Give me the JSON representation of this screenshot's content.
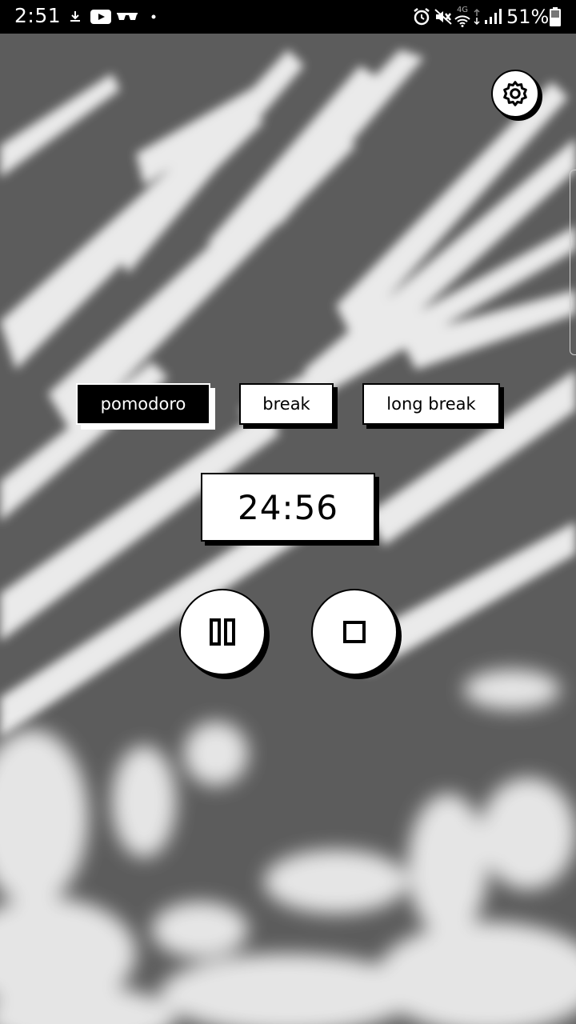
{
  "status_bar": {
    "time": "2:51",
    "battery_percent": "51%",
    "network_type": "4G",
    "left_icons": [
      "download-icon",
      "youtube-icon",
      "glasses-icon",
      "dot-icon"
    ],
    "right_icons": [
      "alarm-icon",
      "mute-icon",
      "wifi-icon",
      "signal-icon",
      "battery-icon"
    ]
  },
  "settings": {
    "icon": "gear-icon"
  },
  "modes": {
    "pomodoro": "pomodoro",
    "break": "break",
    "long_break": "long break",
    "active": "pomodoro"
  },
  "timer": {
    "display": "24:56"
  },
  "controls": {
    "pause_icon": "pause-icon",
    "stop_icon": "stop-icon"
  },
  "colors": {
    "accent": "#000000",
    "surface": "#ffffff",
    "status_bar": "#000000"
  }
}
